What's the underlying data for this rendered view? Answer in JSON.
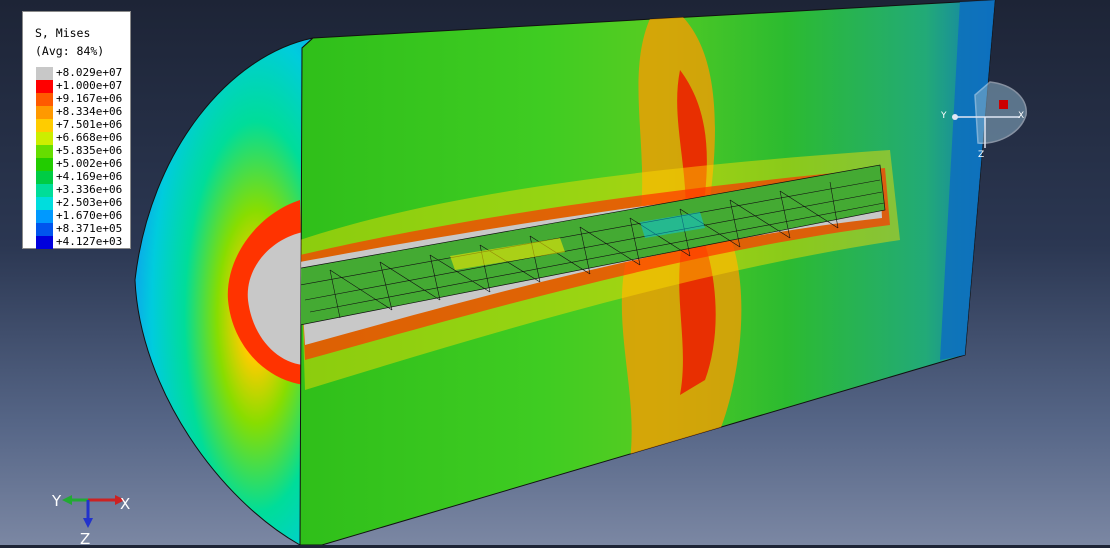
{
  "legend": {
    "title": "S, Mises",
    "avg": "(Avg: 84%)",
    "entries": [
      {
        "value": "+8.029e+07",
        "color": "#c8c8c8"
      },
      {
        "value": "+1.000e+07",
        "color": "#ff0000"
      },
      {
        "value": "+9.167e+06",
        "color": "#ff5a00"
      },
      {
        "value": "+8.334e+06",
        "color": "#ff9900"
      },
      {
        "value": "+7.501e+06",
        "color": "#ffcc00"
      },
      {
        "value": "+6.668e+06",
        "color": "#ccee00"
      },
      {
        "value": "+5.835e+06",
        "color": "#66dd00"
      },
      {
        "value": "+5.002e+06",
        "color": "#22cc00"
      },
      {
        "value": "+4.169e+06",
        "color": "#00cc44"
      },
      {
        "value": "+3.336e+06",
        "color": "#00dd99"
      },
      {
        "value": "+2.503e+06",
        "color": "#00dddd"
      },
      {
        "value": "+1.670e+06",
        "color": "#0099ff"
      },
      {
        "value": "+8.371e+05",
        "color": "#0055ee"
      },
      {
        "value": "+4.127e+03",
        "color": "#0000dd"
      }
    ]
  },
  "triad": {
    "x": "X",
    "y": "Y",
    "z": "Z"
  },
  "mini_triad": {
    "x": "X",
    "y": "Y",
    "z": "Z"
  }
}
